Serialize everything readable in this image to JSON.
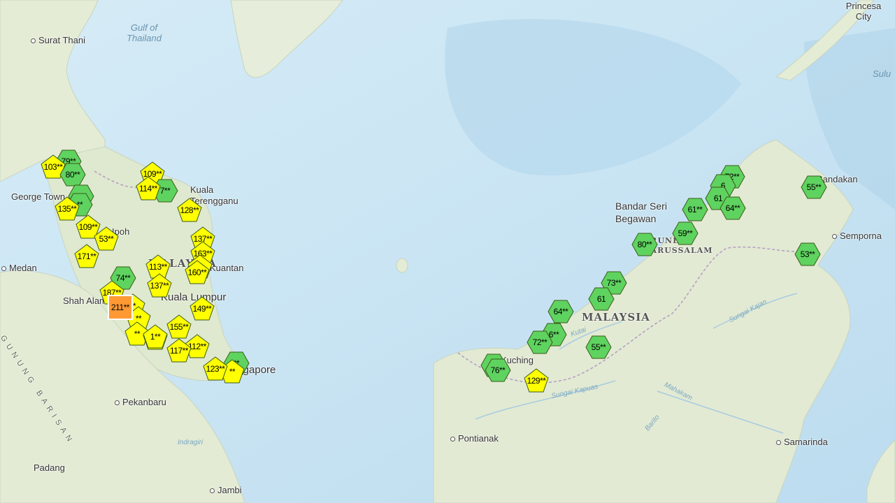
{
  "colors": {
    "good": "#5fd35f",
    "moderate": "#ffff00",
    "unhealthy_sensitive": "#ff9933",
    "water": "#cfe6f4",
    "land": "#e8efdc"
  },
  "places": {
    "surat_thani": "Surat Thani",
    "gulf_of_thailand": "Gulf of Thailand",
    "princesa_city": "Princesa City",
    "sulu": "Sulu",
    "george_town": "George Town",
    "kuala_terengganu": "Kuala Terengganu",
    "medan": "Medan",
    "shah_alam": "Shah Alam",
    "kuala_lumpur": "Kuala Lumpur",
    "kuantan": "Kuantan",
    "ipoh": "Ipoh",
    "singapore": "Singapore",
    "malaysia_west": "MALAYSIA",
    "malaysia_east": "MALAYSIA",
    "pekanbaru": "Pekanbaru",
    "padang": "Padang",
    "jambi": "Jambi",
    "indragiri": "Indragiri",
    "gunung_barisan": "GUNUNG BARISAN",
    "bandar_seri_begawan": "Bandar Seri Begawan",
    "brunei": "BRUNEI DARUSSALAM",
    "sandakan": "Sandakan",
    "semporna": "Semporna",
    "kuching": "Kuching",
    "pontianak": "Pontianak",
    "samarinda": "Samarinda",
    "sungai_kapuas": "Sungai Kapuas",
    "sungai_kayan": "Sungai Kajan",
    "mahakam": "Mahakam",
    "barito": "Barito",
    "kutai": "Kutai"
  },
  "markers": [
    {
      "label": "79**",
      "level": "good",
      "shape": "hexagon"
    },
    {
      "label": "103**",
      "level": "moderate",
      "shape": "pentagon"
    },
    {
      "label": "80**",
      "level": "good",
      "shape": "hexagon"
    },
    {
      "label": "**",
      "level": "good",
      "shape": "hexagon"
    },
    {
      "label": "**",
      "level": "good",
      "shape": "hexagon"
    },
    {
      "label": "135**",
      "level": "moderate",
      "shape": "pentagon"
    },
    {
      "label": "109**",
      "level": "moderate",
      "shape": "pentagon"
    },
    {
      "label": "53**",
      "level": "moderate",
      "shape": "pentagon"
    },
    {
      "label": "171**",
      "level": "moderate",
      "shape": "pentagon"
    },
    {
      "label": "109**",
      "level": "moderate",
      "shape": "pentagon"
    },
    {
      "label": "7**",
      "level": "good",
      "shape": "hexagon"
    },
    {
      "label": "114**",
      "level": "moderate",
      "shape": "pentagon"
    },
    {
      "label": "128**",
      "level": "moderate",
      "shape": "pentagon"
    },
    {
      "label": "137**",
      "level": "moderate",
      "shape": "pentagon"
    },
    {
      "label": "163**",
      "level": "moderate",
      "shape": "pentagon"
    },
    {
      "label": "**",
      "level": "moderate",
      "shape": "pentagon"
    },
    {
      "label": "160**",
      "level": "moderate",
      "shape": "pentagon"
    },
    {
      "label": "74**",
      "level": "good",
      "shape": "hexagon"
    },
    {
      "label": "113**",
      "level": "moderate",
      "shape": "pentagon"
    },
    {
      "label": "137**",
      "level": "moderate",
      "shape": "pentagon"
    },
    {
      "label": "187**",
      "level": "moderate",
      "shape": "pentagon"
    },
    {
      "label": "**",
      "level": "moderate",
      "shape": "pentagon"
    },
    {
      "label": "**",
      "level": "moderate",
      "shape": "pentagon"
    },
    {
      "label": "**",
      "level": "moderate",
      "shape": "pentagon"
    },
    {
      "label": "211**",
      "level": "unhealthy_sensitive",
      "shape": "square"
    },
    {
      "label": "149**",
      "level": "moderate",
      "shape": "pentagon"
    },
    {
      "label": "**",
      "level": "moderate",
      "shape": "pentagon"
    },
    {
      "label": "1**",
      "level": "moderate",
      "shape": "pentagon"
    },
    {
      "label": "155**",
      "level": "moderate",
      "shape": "pentagon"
    },
    {
      "label": "112**",
      "level": "moderate",
      "shape": "pentagon"
    },
    {
      "label": "117**",
      "level": "moderate",
      "shape": "pentagon"
    },
    {
      "label": "**",
      "level": "good",
      "shape": "hexagon"
    },
    {
      "label": "**",
      "level": "moderate",
      "shape": "pentagon"
    },
    {
      "label": "123**",
      "level": "moderate",
      "shape": "pentagon"
    },
    {
      "label": "72**",
      "level": "good",
      "shape": "hexagon"
    },
    {
      "label": "6",
      "level": "good",
      "shape": "hexagon"
    },
    {
      "label": "61",
      "level": "good",
      "shape": "hexagon"
    },
    {
      "label": "61**",
      "level": "good",
      "shape": "hexagon"
    },
    {
      "label": "64**",
      "level": "good",
      "shape": "hexagon"
    },
    {
      "label": "55**",
      "level": "good",
      "shape": "hexagon"
    },
    {
      "label": "59**",
      "level": "good",
      "shape": "hexagon"
    },
    {
      "label": "80**",
      "level": "good",
      "shape": "hexagon"
    },
    {
      "label": "53**",
      "level": "good",
      "shape": "hexagon"
    },
    {
      "label": "73**",
      "level": "good",
      "shape": "hexagon"
    },
    {
      "label": "61",
      "level": "good",
      "shape": "hexagon"
    },
    {
      "label": "64**",
      "level": "good",
      "shape": "hexagon"
    },
    {
      "label": "6**",
      "level": "good",
      "shape": "hexagon"
    },
    {
      "label": "72**",
      "level": "good",
      "shape": "hexagon"
    },
    {
      "label": "55**",
      "level": "good",
      "shape": "hexagon"
    },
    {
      "label": "**",
      "level": "good",
      "shape": "hexagon"
    },
    {
      "label": "76**",
      "level": "good",
      "shape": "hexagon"
    },
    {
      "label": "129**",
      "level": "moderate",
      "shape": "pentagon"
    }
  ]
}
